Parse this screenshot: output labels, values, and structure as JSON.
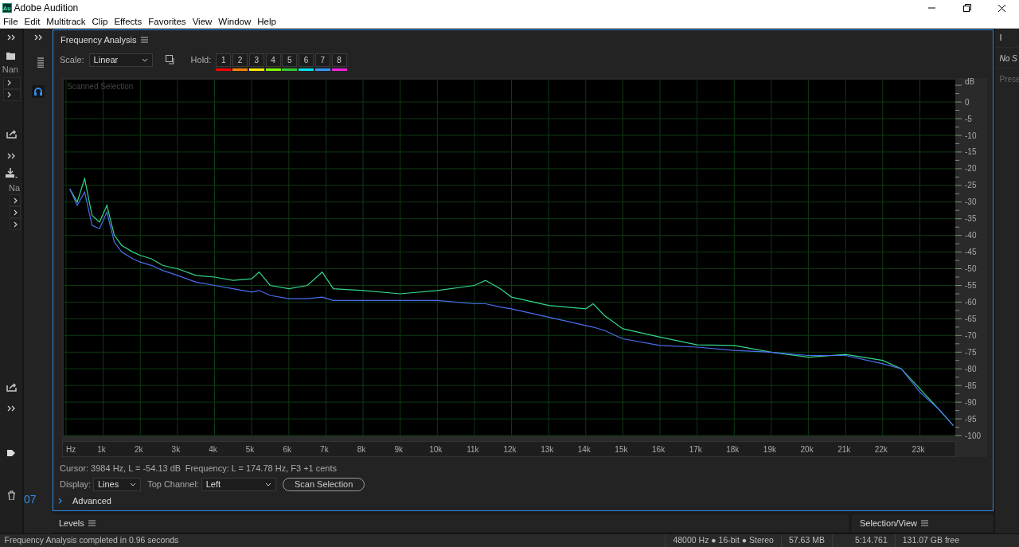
{
  "window": {
    "title": "Adobe Audition",
    "logo": "Au"
  },
  "menu": [
    "File",
    "Edit",
    "Multitrack",
    "Clip",
    "Effects",
    "Favorites",
    "View",
    "Window",
    "Help"
  ],
  "left_dock": {
    "files_header": "Nan",
    "media_header": "Na"
  },
  "second_dock": {
    "time_fragment": "07"
  },
  "right_dock": {
    "tab_fragment": "I",
    "status_fragment": "No S",
    "preset_fragment": "Prese"
  },
  "panel": {
    "title": "Frequency Analysis",
    "scale_label": "Scale:",
    "scale_value": "Linear",
    "hold_label": "Hold:",
    "holds": [
      {
        "label": "1",
        "color": "#ff0000"
      },
      {
        "label": "2",
        "color": "#ff8000"
      },
      {
        "label": "3",
        "color": "#ffee00"
      },
      {
        "label": "4",
        "color": "#80ff00"
      },
      {
        "label": "5",
        "color": "#33cc33"
      },
      {
        "label": "6",
        "color": "#00e5f0"
      },
      {
        "label": "7",
        "color": "#3399ff"
      },
      {
        "label": "8",
        "color": "#ff22dd"
      }
    ],
    "chart_data": {
      "type": "line",
      "title": "Scanned Selection",
      "ylabel": "dB",
      "x": [
        100,
        300,
        500,
        700,
        900,
        1100,
        1300,
        1500,
        1800,
        2000,
        2300,
        2600,
        3000,
        3500,
        4000,
        4500,
        5000,
        5200,
        5500,
        6000,
        6500,
        6900,
        7200,
        8000,
        9000,
        10000,
        11000,
        11300,
        11700,
        12000,
        13000,
        14000,
        14200,
        14500,
        15000,
        16000,
        17000,
        18000,
        19000,
        20000,
        21000,
        22000,
        22500,
        23000,
        23500,
        23900
      ],
      "series": [
        {
          "color": "#35d68a",
          "values": [
            -26,
            -30,
            -23,
            -34,
            -36,
            -31,
            -40,
            -43,
            -45,
            -46,
            -47,
            -49,
            -50,
            -52,
            -52.5,
            -53.5,
            -53,
            -51,
            -55,
            -56,
            -55,
            -51,
            -56,
            -56.5,
            -57.5,
            -56.5,
            -55,
            -53.5,
            -56,
            -58.5,
            -61,
            -62,
            -60.5,
            -64,
            -68,
            -70.5,
            -72.8,
            -73,
            -75,
            -76.5,
            -75.7,
            -77.5,
            -80,
            -86,
            -92,
            -97
          ]
        },
        {
          "color": "#4a6ff0",
          "values": [
            -26,
            -31,
            -27,
            -37,
            -38,
            -33,
            -42,
            -45,
            -47,
            -48,
            -49,
            -50.5,
            -52,
            -54,
            -55,
            -56,
            -57,
            -56.5,
            -58,
            -59,
            -59,
            -58.5,
            -59.5,
            -59.5,
            -59.5,
            -59.5,
            -60.5,
            -60.5,
            -61.5,
            -62,
            -64.5,
            -67,
            -67.5,
            -68.5,
            -71,
            -73,
            -73.5,
            -74.5,
            -75,
            -76,
            -76,
            -78.5,
            -80,
            -87,
            -92,
            -97
          ]
        }
      ],
      "xlim": [
        -64,
        23955
      ],
      "ylim": [
        -100,
        6.7
      ],
      "grid": true,
      "xticks": [
        {
          "value": 0,
          "label": "Hz"
        },
        {
          "value": 1000,
          "label": "1k"
        },
        {
          "value": 2000,
          "label": "2k"
        },
        {
          "value": 3000,
          "label": "3k"
        },
        {
          "value": 4000,
          "label": "4k"
        },
        {
          "value": 5000,
          "label": "5k"
        },
        {
          "value": 6000,
          "label": "6k"
        },
        {
          "value": 7000,
          "label": "7k"
        },
        {
          "value": 8000,
          "label": "8k"
        },
        {
          "value": 9000,
          "label": "9k"
        },
        {
          "value": 10000,
          "label": "10k"
        },
        {
          "value": 11000,
          "label": "11k"
        },
        {
          "value": 12000,
          "label": "12k"
        },
        {
          "value": 13000,
          "label": "13k"
        },
        {
          "value": 14000,
          "label": "14k"
        },
        {
          "value": 15000,
          "label": "15k"
        },
        {
          "value": 16000,
          "label": "16k"
        },
        {
          "value": 17000,
          "label": "17k"
        },
        {
          "value": 18000,
          "label": "18k"
        },
        {
          "value": 19000,
          "label": "19k"
        },
        {
          "value": 20000,
          "label": "20k"
        },
        {
          "value": 21000,
          "label": "21k"
        },
        {
          "value": 22000,
          "label": "22k"
        },
        {
          "value": 23000,
          "label": "23k"
        }
      ],
      "yticks": [
        0,
        -5,
        -10,
        -15,
        -20,
        -25,
        -30,
        -35,
        -40,
        -45,
        -50,
        -55,
        -60,
        -65,
        -70,
        -75,
        -80,
        -85,
        -90,
        -95,
        -100
      ]
    },
    "cursor_readout": "Cursor: 3984 Hz, L = -54.13 dB",
    "frequency_readout": "Frequency: L = 174.78 Hz, F3 +1 cents",
    "display_label": "Display:",
    "display_value": "Lines",
    "top_channel_label": "Top Channel:",
    "top_channel_value": "Left",
    "scan_button": "Scan Selection",
    "advanced_label": "Advanced"
  },
  "bottom_panels": [
    {
      "title": "Levels"
    },
    {
      "title": "Selection/View"
    }
  ],
  "status_bar": {
    "message": "Frequency Analysis completed in 0.96 seconds",
    "fields": [
      "48000 Hz ● 16-bit ● Stereo",
      "57.63 MB",
      "5:14.761",
      "131.07 GB free"
    ]
  }
}
